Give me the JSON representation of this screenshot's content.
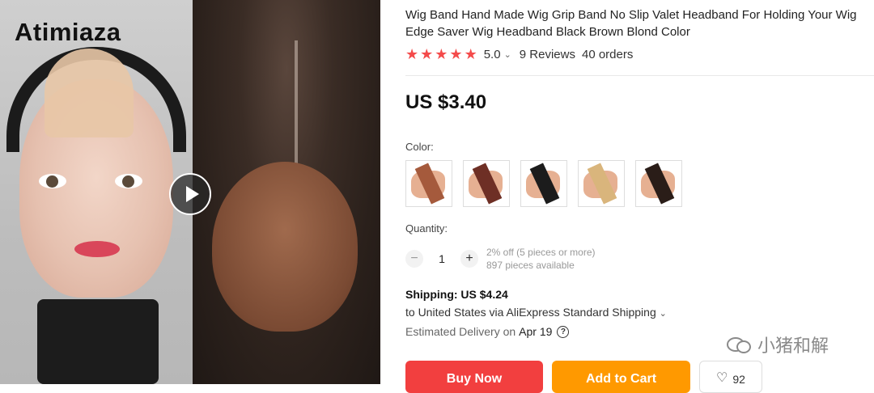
{
  "gallery": {
    "brand_label": "Atimiaza",
    "play_icon": "play-icon"
  },
  "product": {
    "title": "Wig Band Hand Made Wig Grip Band No Slip Valet Headband For Holding Your Wig Edge Saver Wig Headband Black Brown Blond Color",
    "rating": "5.0",
    "reviews": "9 Reviews",
    "orders": "40 orders",
    "star_color": "#f44b4b",
    "price": "US $3.40"
  },
  "color_section": {
    "label": "Color:",
    "swatches": [
      {
        "strip": "#a55a3c"
      },
      {
        "strip": "#6e2f25"
      },
      {
        "strip": "#1c1c1c"
      },
      {
        "strip": "#d9b57c"
      },
      {
        "strip": "#2a1d18"
      }
    ]
  },
  "quantity": {
    "label": "Quantity:",
    "value": "1",
    "discount": "2% off (5 pieces or more)",
    "available": "897 pieces available"
  },
  "shipping": {
    "cost": "Shipping: US $4.24",
    "route": "to United States via AliExpress Standard Shipping",
    "delivery_label": "Estimated Delivery on",
    "delivery_date": "Apr 19"
  },
  "actions": {
    "buy_now": "Buy Now",
    "add_to_cart": "Add to Cart",
    "wishlist_count": "92",
    "buy_color": "#f23f3f",
    "cart_color": "#ff9900"
  },
  "watermark": {
    "text": "小猪和解"
  }
}
